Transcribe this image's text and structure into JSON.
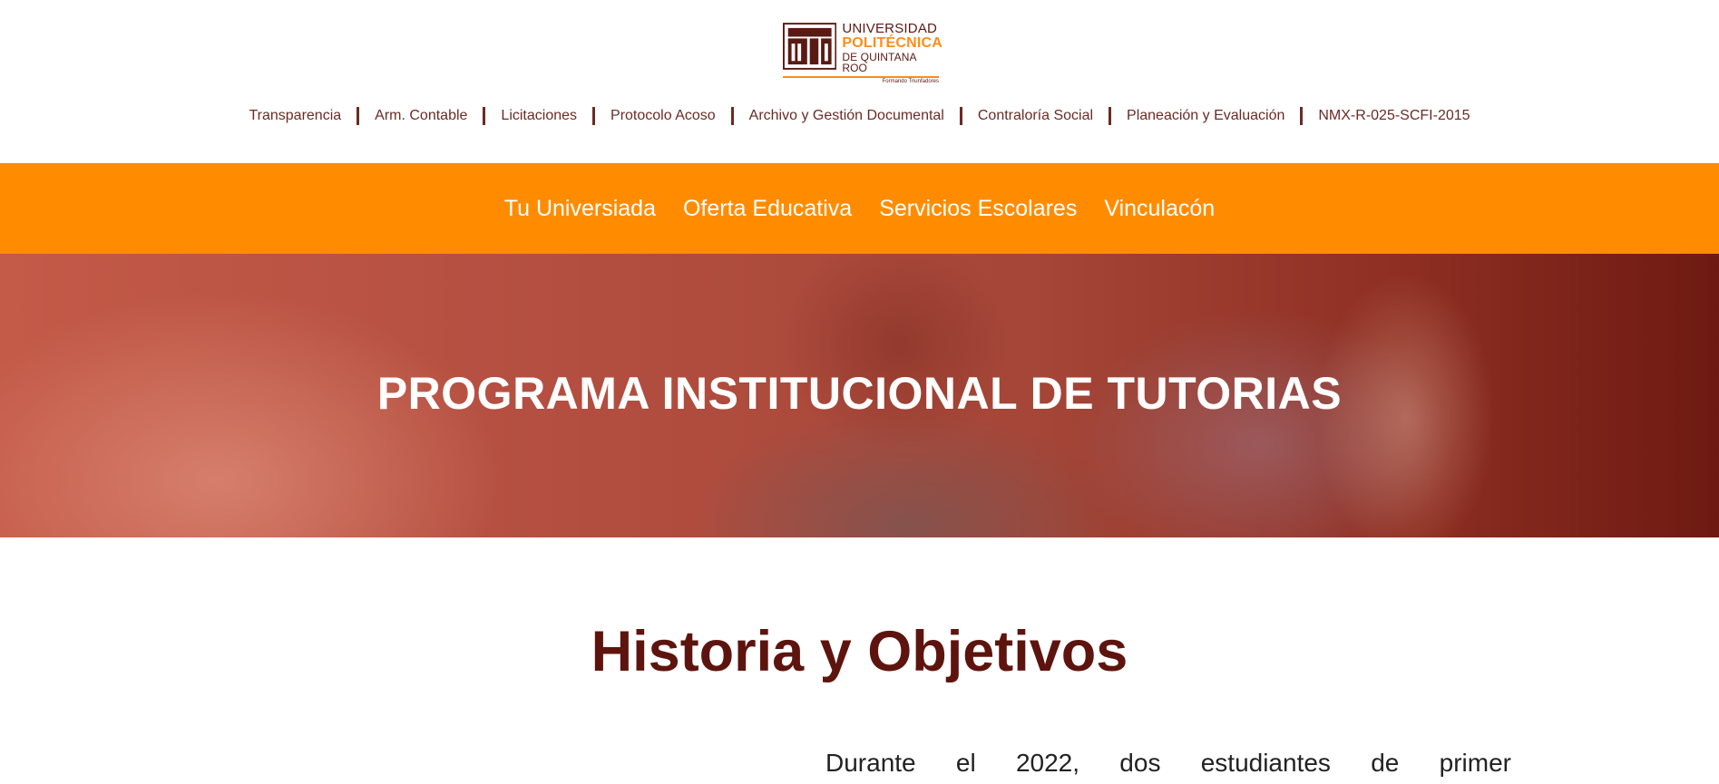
{
  "logo": {
    "line1": "UNIVERSIDAD",
    "line2": "POLITÉCNICA",
    "line3": "DE QUINTANA ROO",
    "tagline": "Formando Triunfadores",
    "colors": {
      "brand_dark": "#5a1a14",
      "brand_orange": "#ff8c1a"
    }
  },
  "top_nav": {
    "items": [
      {
        "label": "Transparencia"
      },
      {
        "label": "Arm. Contable"
      },
      {
        "label": "Licitaciones"
      },
      {
        "label": "Protocolo Acoso"
      },
      {
        "label": "Archivo y Gestión Documental"
      },
      {
        "label": "Contraloría Social"
      },
      {
        "label": "Planeación y Evaluación"
      },
      {
        "label": "NMX-R-025-SCFI-2015"
      }
    ]
  },
  "main_nav": {
    "items": [
      {
        "label": "Tu Universiada"
      },
      {
        "label": "Oferta Educativa"
      },
      {
        "label": "Servicios Escolares"
      },
      {
        "label": "Vinculacón"
      }
    ],
    "background": "#ff8c00"
  },
  "hero": {
    "title": "PROGRAMA INSTITUCIONAL DE TUTORIAS"
  },
  "section": {
    "title": "Historia y Objetivos",
    "paragraph_words": [
      "Durante",
      "el",
      "2022,",
      "dos",
      "estudiantes",
      "de",
      "primer"
    ]
  }
}
